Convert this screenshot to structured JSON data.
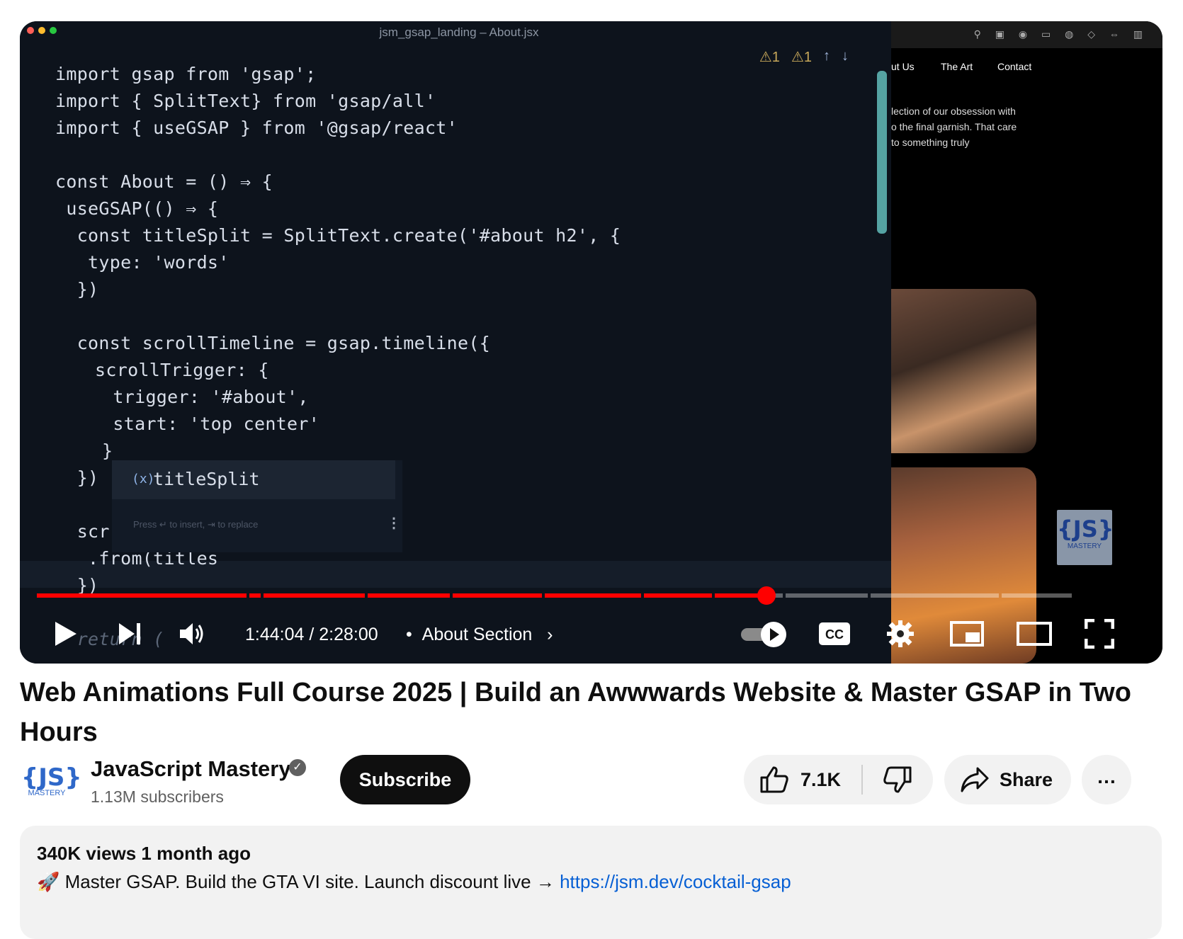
{
  "player": {
    "editor_title": "jsm_gsap_landing – About.jsx",
    "code_lines": [
      "import gsap from 'gsap';",
      "import { SplitText} from 'gsap/all'",
      "import { useGSAP } from '@gsap/react'",
      "const About = () ⇒ {",
      " useGSAP(() ⇒ {",
      "  const titleSplit = SplitText.create('#about h2', {",
      "   type: 'words'",
      "  })",
      "  const scrollTimeline = gsap.timeline({",
      "   scrollTrigger: {",
      "    trigger: '#about',",
      "    start: 'top center'",
      "   }",
      "  })",
      "  scr",
      "   .from(titles",
      "  })",
      "  return ("
    ],
    "autocomplete": {
      "kind": "(x)",
      "suggestion": "titleSplit",
      "hint": "Press ↵ to insert, ⇥ to replace"
    },
    "warnings": [
      "⚠1",
      "⚠1"
    ],
    "preview": {
      "nav": [
        "ut Us",
        "The Art",
        "Contact"
      ],
      "text": "lection of our obsession with\no the final garnish. That care\nto something truly"
    },
    "watermark": {
      "logo": "{JS}",
      "text": "MASTERY"
    },
    "time": "1:44:04 / 2:28:00",
    "chapter": "About Section",
    "progress": 0.703,
    "colors": {
      "progress": "#ff0000",
      "buffer": "#ffffff",
      "accent": "#ff0000"
    }
  },
  "video": {
    "title": "Web Animations Full Course 2025 | Build an Awwwards Website & Master GSAP in Two Hours"
  },
  "channel": {
    "avatar_logo": "{JS}",
    "avatar_text": "MASTERY",
    "name": "JavaScript Mastery",
    "verified_icon": "✓",
    "subscribers": "1.13M subscribers",
    "subscribe_label": "Subscribe"
  },
  "actions": {
    "likes": "7.1K",
    "share_label": "Share",
    "more_label": "…"
  },
  "description": {
    "meta": "340K views  1 month ago",
    "emoji": "🚀",
    "text": " Master GSAP. Build the GTA VI site. Launch discount live → ",
    "link": "https://jsm.dev/cocktail-gsap"
  }
}
